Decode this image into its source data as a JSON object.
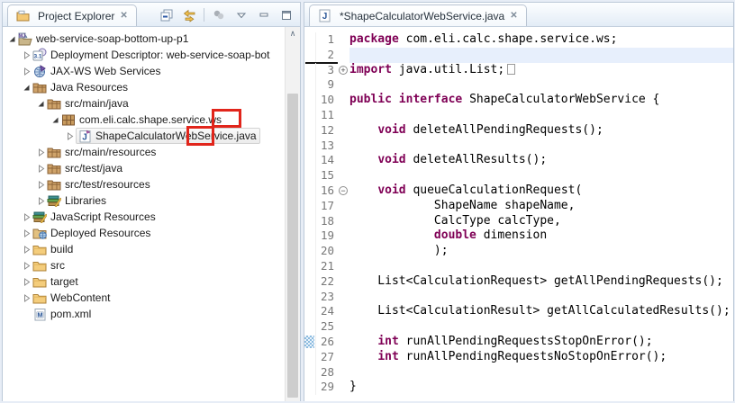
{
  "colors": {
    "keyword": "#7f0055",
    "annotation_red": "#e1251b",
    "current_line": "#e7effc",
    "line_number": "#787878"
  },
  "explorer": {
    "tab_label": "Project Explorer",
    "toolbar_icons": [
      "collapse-all",
      "link-with-editor",
      "focus-on-active-task",
      "view-menu",
      "minimize",
      "maximize"
    ],
    "scrollbar": {
      "up_arrow": "∧"
    },
    "tree": [
      {
        "label": "web-service-soap-bottom-up-p1",
        "level": 0,
        "state": "expanded",
        "icon": "project"
      },
      {
        "label": "Deployment Descriptor: web-service-soap-bot",
        "level": 1,
        "state": "collapsed",
        "icon": "deployment-descriptor"
      },
      {
        "label": "JAX-WS Web Services",
        "level": 1,
        "state": "collapsed",
        "icon": "jaxws"
      },
      {
        "label": "Java Resources",
        "level": 1,
        "state": "expanded",
        "icon": "source-folder"
      },
      {
        "label": "src/main/java",
        "level": 2,
        "state": "expanded",
        "icon": "source-folder"
      },
      {
        "label": "com.eli.calc.shape.service.ws",
        "level": 3,
        "state": "expanded",
        "icon": "package"
      },
      {
        "label": "ShapeCalculatorWebService.java",
        "level": 4,
        "state": "collapsed",
        "icon": "java-file",
        "selected": true
      },
      {
        "label": "src/main/resources",
        "level": 2,
        "state": "collapsed",
        "icon": "source-folder"
      },
      {
        "label": "src/test/java",
        "level": 2,
        "state": "collapsed",
        "icon": "source-folder"
      },
      {
        "label": "src/test/resources",
        "level": 2,
        "state": "collapsed",
        "icon": "source-folder"
      },
      {
        "label": "Libraries",
        "level": 2,
        "state": "collapsed",
        "icon": "libraries"
      },
      {
        "label": "JavaScript Resources",
        "level": 1,
        "state": "collapsed",
        "icon": "libraries"
      },
      {
        "label": "Deployed Resources",
        "level": 1,
        "state": "collapsed",
        "icon": "deployed-resources"
      },
      {
        "label": "build",
        "level": 1,
        "state": "collapsed",
        "icon": "folder"
      },
      {
        "label": "src",
        "level": 1,
        "state": "collapsed",
        "icon": "folder"
      },
      {
        "label": "target",
        "level": 1,
        "state": "collapsed",
        "icon": "folder"
      },
      {
        "label": "WebContent",
        "level": 1,
        "state": "collapsed",
        "icon": "folder"
      },
      {
        "label": "pom.xml",
        "level": 1,
        "state": "none",
        "icon": "pom"
      }
    ],
    "annotations": [
      {
        "name": "package-suffix-highlight",
        "target_text": "ws"
      },
      {
        "name": "filename-web-highlight",
        "target_text": "Web"
      }
    ]
  },
  "editor": {
    "tab_label": "*ShapeCalculatorWebService.java",
    "dirty": true,
    "lines": [
      {
        "n": "1",
        "segs": [
          [
            "k",
            "package "
          ],
          [
            "p",
            "com.eli.calc.shape.service.ws;"
          ]
        ]
      },
      {
        "n": "2",
        "cur": true,
        "underline": true,
        "segs": []
      },
      {
        "n": "3",
        "fold": "plus",
        "foldbox": true,
        "segs": [
          [
            "k",
            "import "
          ],
          [
            "p",
            "java.util.List;"
          ]
        ]
      },
      {
        "n": "9",
        "segs": []
      },
      {
        "n": "10",
        "segs": [
          [
            "k",
            "public interface "
          ],
          [
            "p",
            "ShapeCalculatorWebService {"
          ]
        ]
      },
      {
        "n": "11",
        "segs": []
      },
      {
        "n": "12",
        "segs": [
          [
            "p",
            "    "
          ],
          [
            "k",
            "void "
          ],
          [
            "p",
            "deleteAllPendingRequests();"
          ]
        ]
      },
      {
        "n": "13",
        "segs": []
      },
      {
        "n": "14",
        "segs": [
          [
            "p",
            "    "
          ],
          [
            "k",
            "void "
          ],
          [
            "p",
            "deleteAllResults();"
          ]
        ]
      },
      {
        "n": "15",
        "segs": []
      },
      {
        "n": "16",
        "fold": "minus",
        "segs": [
          [
            "p",
            "    "
          ],
          [
            "k",
            "void "
          ],
          [
            "p",
            "queueCalculationRequest("
          ]
        ]
      },
      {
        "n": "17",
        "segs": [
          [
            "p",
            "            ShapeName shapeName,"
          ]
        ]
      },
      {
        "n": "18",
        "segs": [
          [
            "p",
            "            CalcType calcType,"
          ]
        ]
      },
      {
        "n": "19",
        "segs": [
          [
            "p",
            "            "
          ],
          [
            "k",
            "double "
          ],
          [
            "p",
            "dimension"
          ]
        ]
      },
      {
        "n": "20",
        "segs": [
          [
            "p",
            "            );"
          ]
        ]
      },
      {
        "n": "21",
        "segs": []
      },
      {
        "n": "22",
        "segs": [
          [
            "p",
            "    List<CalculationRequest> getAllPendingRequests();"
          ]
        ]
      },
      {
        "n": "23",
        "segs": []
      },
      {
        "n": "24",
        "segs": [
          [
            "p",
            "    List<CalculationResult> getAllCalculatedResults();"
          ]
        ]
      },
      {
        "n": "25",
        "segs": []
      },
      {
        "n": "26",
        "marker": true,
        "segs": [
          [
            "p",
            "    "
          ],
          [
            "k",
            "int "
          ],
          [
            "p",
            "runAllPendingRequestsStopOnError();"
          ]
        ]
      },
      {
        "n": "27",
        "segs": [
          [
            "p",
            "    "
          ],
          [
            "k",
            "int "
          ],
          [
            "p",
            "runAllPendingRequestsNoStopOnError();"
          ]
        ]
      },
      {
        "n": "28",
        "segs": []
      },
      {
        "n": "29",
        "segs": [
          [
            "p",
            "}"
          ]
        ]
      }
    ]
  }
}
